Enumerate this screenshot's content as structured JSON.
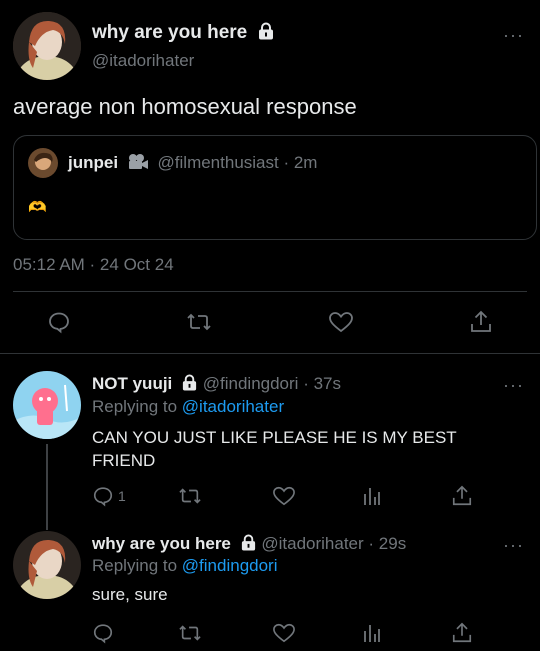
{
  "main_tweet": {
    "display_name": "why are you here",
    "handle": "@itadorihater",
    "text": "average non homosexual response",
    "timestamp": "05:12 AM · 24 Oct 24",
    "quote": {
      "display_name": "junpei",
      "handle": "@filmenthusiast",
      "time": "· 2m",
      "emoji": "🫶"
    }
  },
  "reply1": {
    "display_name": "NOT yuuji",
    "handle": "@findingdori",
    "time": "· 37s",
    "replying_prefix": "Replying to",
    "replying_to": "@itadorihater",
    "text": "CAN YOU JUST LIKE PLEASE HE IS MY BEST FRIEND",
    "reply_count": "1"
  },
  "reply2": {
    "display_name": "why are you here",
    "handle": "@itadorihater",
    "time": "· 29s",
    "replying_prefix": "Replying to",
    "replying_to": "@findingdori",
    "text": "sure, sure"
  },
  "colors": {
    "background": "#000000",
    "muted": "#71767b",
    "link": "#1d9bf0",
    "divider": "#2f3336"
  }
}
